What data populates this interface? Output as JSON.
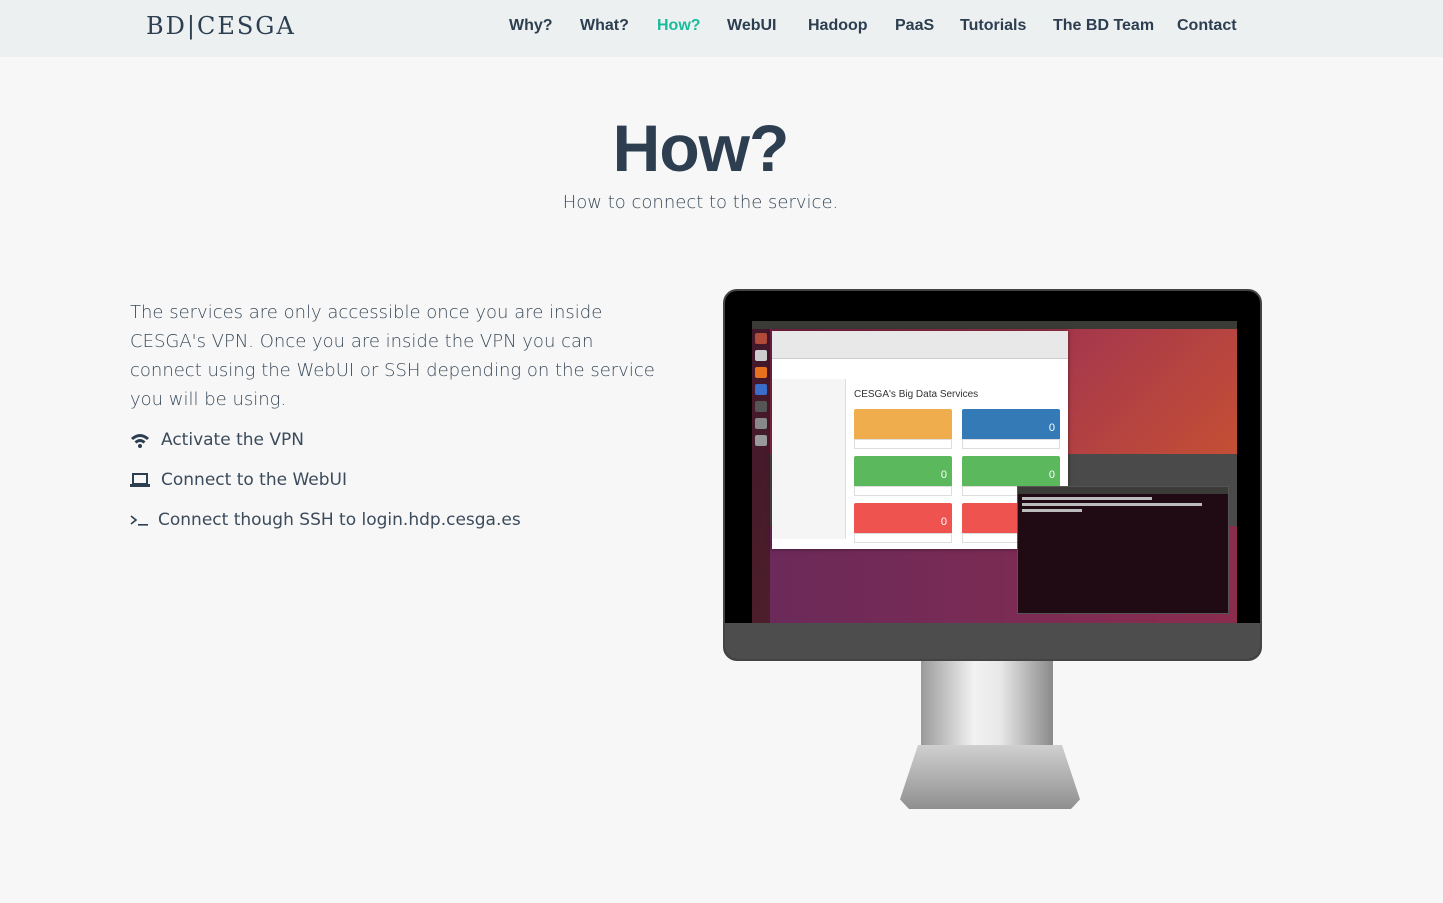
{
  "brand": "BD|CESGA",
  "nav": [
    {
      "label": "Why?",
      "active": false
    },
    {
      "label": "What?",
      "active": false
    },
    {
      "label": "How?",
      "active": true
    },
    {
      "label": "WebUI",
      "active": false
    },
    {
      "label": "Hadoop",
      "active": false
    },
    {
      "label": "PaaS",
      "active": false
    },
    {
      "label": "Tutorials",
      "active": false
    },
    {
      "label": "The BD Team",
      "active": false
    },
    {
      "label": "Contact",
      "active": false
    }
  ],
  "header": {
    "title": "How?",
    "subtitle": "How to connect to the service."
  },
  "content": {
    "intro": "The services are only accessible once you are inside CESGA's VPN. Once you are inside the VPN you can connect using the WebUI or SSH depending on the service you will be using.",
    "steps": [
      {
        "icon": "wifi-icon",
        "label": "Activate the VPN"
      },
      {
        "icon": "laptop-icon",
        "label": "Connect to the WebUI"
      },
      {
        "icon": "terminal-icon",
        "label": "Connect though SSH to login.hdp.cesga.es"
      }
    ]
  },
  "illustration": {
    "portal_title": "CESGA's Big Data Services",
    "tiles": [
      {
        "color": "#f0ad4e",
        "value": ""
      },
      {
        "color": "#337ab7",
        "value": "0"
      },
      {
        "color": "#5cb85c",
        "value": "0"
      },
      {
        "color": "#5cb85c",
        "value": "0"
      },
      {
        "color": "#ef5350",
        "value": "0"
      },
      {
        "color": "#ef5350",
        "value": ""
      }
    ]
  },
  "colors": {
    "accent": "#18bc9c",
    "primary": "#2c3e50",
    "navbar_bg": "#ecf0f1"
  }
}
